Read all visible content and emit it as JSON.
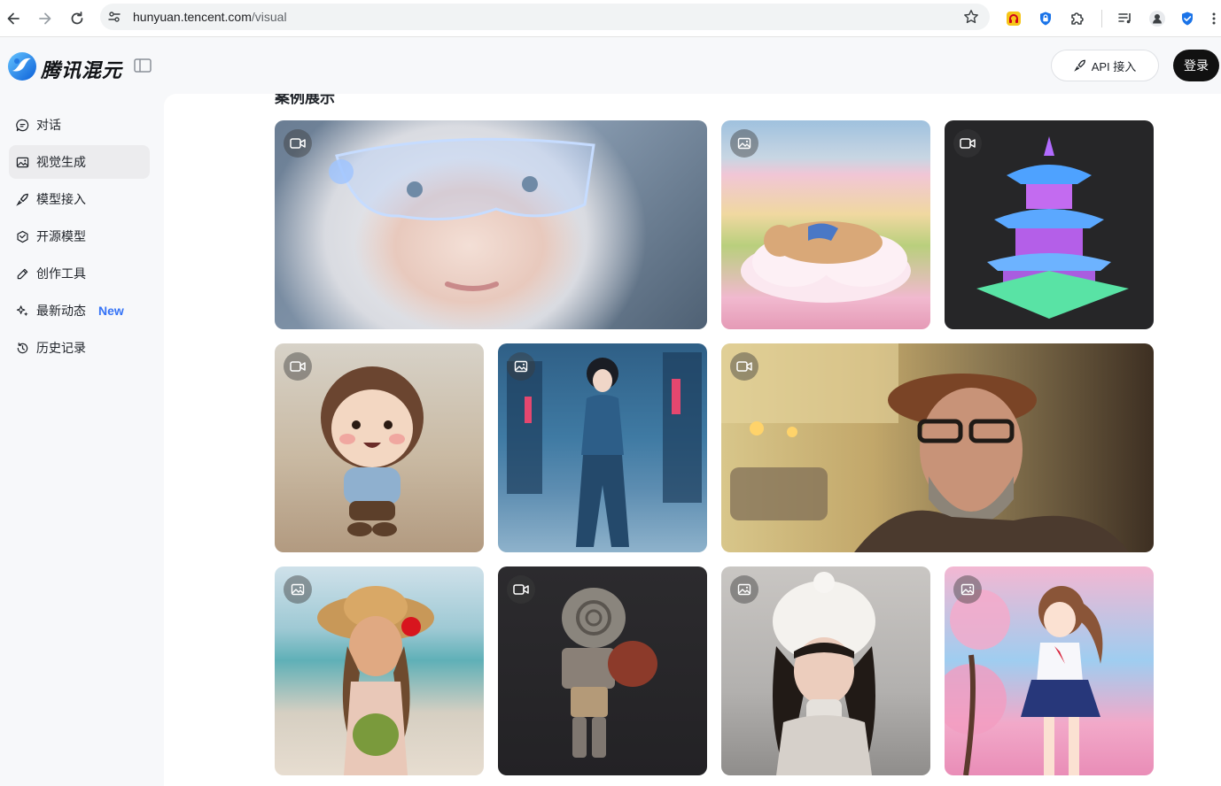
{
  "browser": {
    "url_host": "hunyuan.tencent.com",
    "url_path": "/visual"
  },
  "header": {
    "brand": "腾讯混元",
    "api_label": "API 接入",
    "login_label": "登录"
  },
  "sidebar": {
    "items": [
      {
        "label": "对话",
        "icon": "chat-icon"
      },
      {
        "label": "视觉生成",
        "icon": "image-icon",
        "active": true
      },
      {
        "label": "模型接入",
        "icon": "rocket-icon"
      },
      {
        "label": "开源模型",
        "icon": "cube-icon"
      },
      {
        "label": "创作工具",
        "icon": "pen-icon"
      },
      {
        "label": "最新动态",
        "icon": "sparkle-icon",
        "badge": "New"
      },
      {
        "label": "历史记录",
        "icon": "history-icon"
      }
    ]
  },
  "main": {
    "section_title": "案例展示",
    "cards": [
      {
        "name": "card-glasses-girl",
        "type": "video"
      },
      {
        "name": "card-cat-clouds",
        "type": "image"
      },
      {
        "name": "card-pagoda-3d",
        "type": "video"
      },
      {
        "name": "card-felt-doll",
        "type": "video"
      },
      {
        "name": "card-cyborg-girl",
        "type": "image"
      },
      {
        "name": "card-old-man-beret",
        "type": "video"
      },
      {
        "name": "card-beach-girl",
        "type": "image"
      },
      {
        "name": "card-robot-boxer",
        "type": "video"
      },
      {
        "name": "card-snow-girl",
        "type": "image"
      },
      {
        "name": "card-anime-sakura",
        "type": "image"
      }
    ]
  },
  "colors": {
    "accent_new": "#3573f6",
    "login_bg": "#111111"
  }
}
